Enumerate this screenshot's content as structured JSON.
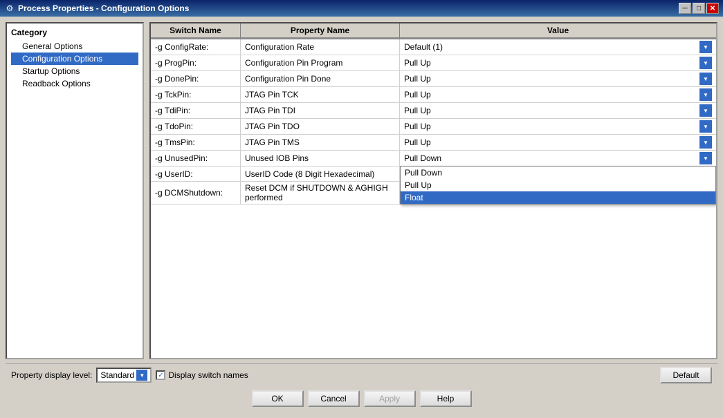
{
  "window": {
    "title": "Process Properties - Configuration Options",
    "icon": "⚙"
  },
  "title_buttons": {
    "minimize": "─",
    "maximize": "□",
    "close": "✕"
  },
  "category": {
    "label": "Category",
    "items": [
      {
        "id": "general",
        "label": "General Options",
        "level": "child",
        "selected": false
      },
      {
        "id": "configuration",
        "label": "Configuration Options",
        "level": "child",
        "selected": true
      },
      {
        "id": "startup",
        "label": "Startup Options",
        "level": "child",
        "selected": false
      },
      {
        "id": "readback",
        "label": "Readback Options",
        "level": "child",
        "selected": false
      }
    ]
  },
  "table": {
    "headers": [
      "Switch Name",
      "Property Name",
      "Value"
    ],
    "rows": [
      {
        "switch": "-g ConfigRate:",
        "property": "Configuration Rate",
        "value": "Default (1)",
        "has_dropdown": true
      },
      {
        "switch": "-g ProgPin:",
        "property": "Configuration Pin Program",
        "value": "Pull Up",
        "has_dropdown": true
      },
      {
        "switch": "-g DonePin:",
        "property": "Configuration Pin Done",
        "value": "Pull Up",
        "has_dropdown": true
      },
      {
        "switch": "-g TckPin:",
        "property": "JTAG Pin TCK",
        "value": "Pull Up",
        "has_dropdown": true
      },
      {
        "switch": "-g TdiPin:",
        "property": "JTAG Pin TDI",
        "value": "Pull Up",
        "has_dropdown": true
      },
      {
        "switch": "-g TdoPin:",
        "property": "JTAG Pin TDO",
        "value": "Pull Up",
        "has_dropdown": true
      },
      {
        "switch": "-g TmsPin:",
        "property": "JTAG Pin TMS",
        "value": "Pull Up",
        "has_dropdown": true
      },
      {
        "switch": "-g UnusedPin:",
        "property": "Unused IOB Pins",
        "value": "Pull Down",
        "has_dropdown": true,
        "dropdown_open": true
      },
      {
        "switch": "-g UserID:",
        "property": "UserID Code (8 Digit Hexadecimal)",
        "value": "",
        "has_dropdown": false
      },
      {
        "switch": "-g DCMShutdown:",
        "property": "Reset DCM if SHUTDOWN & AGHIGH performed",
        "value": "",
        "has_dropdown": false
      }
    ],
    "dropdown_options": [
      "Pull Down",
      "Pull Up",
      "Float"
    ],
    "dropdown_selected": "Float"
  },
  "toolbar": {
    "property_level_label": "Property display level:",
    "level_value": "Standard",
    "display_switch_names_label": "Display switch names",
    "default_button": "Default"
  },
  "buttons": {
    "ok": "OK",
    "cancel": "Cancel",
    "apply": "Apply",
    "help": "Help"
  }
}
